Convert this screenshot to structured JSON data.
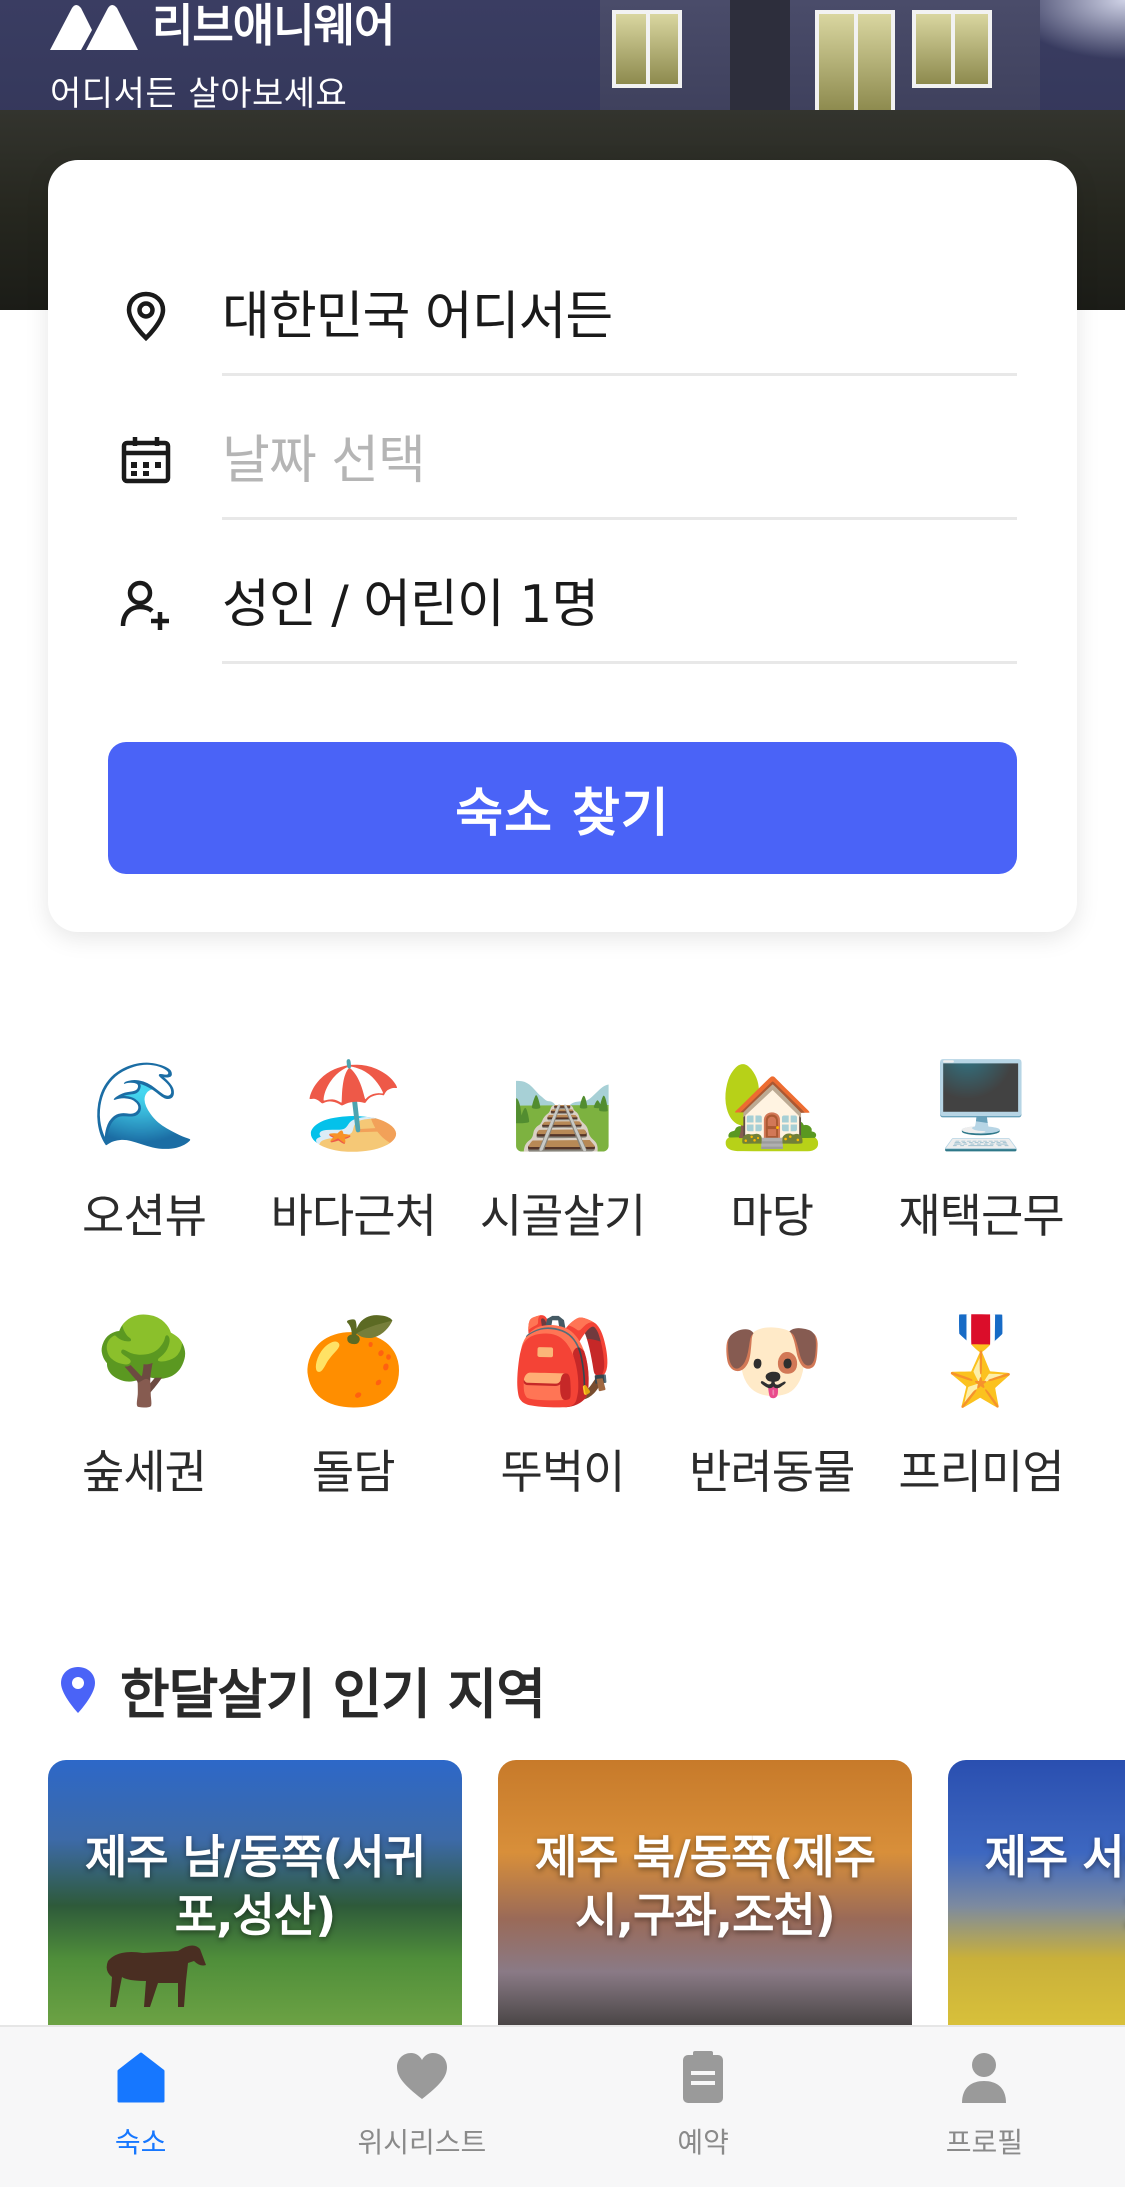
{
  "brand": {
    "name": "리브애니웨어",
    "tagline": "어디서든 살아보세요"
  },
  "search": {
    "location_value": "대한민국 어디서든",
    "date_placeholder": "날짜 선택",
    "guests_value": "성인 / 어린이 1명",
    "submit_label": "숙소 찾기",
    "accent_color": "#4a63f7"
  },
  "categories": [
    {
      "emoji": "🌊",
      "label": "오션뷰"
    },
    {
      "emoji": "🏖️",
      "label": "바다근처"
    },
    {
      "emoji": "🛤️",
      "label": "시골살기"
    },
    {
      "emoji": "🏡",
      "label": "마당"
    },
    {
      "emoji": "🖥️",
      "label": "재택근무"
    },
    {
      "emoji": "🌳",
      "label": "숲세권"
    },
    {
      "emoji": "🍊",
      "label": "돌담"
    },
    {
      "emoji": "🎒",
      "label": "뚜벅이"
    },
    {
      "emoji": "🐶",
      "label": "반려동물"
    },
    {
      "emoji": "🎖️",
      "label": "프리미엄"
    }
  ],
  "popular": {
    "title": "한달살기 인기 지역",
    "regions": [
      {
        "title": "제주 남/동쪽(서귀포,성산)"
      },
      {
        "title": "제주 북/동쪽(제주시,구좌,조천)"
      },
      {
        "title": "제주 서쪽(한림,협재)"
      }
    ]
  },
  "nav": {
    "items": [
      {
        "label": "숙소",
        "icon": "home-icon",
        "active": true
      },
      {
        "label": "위시리스트",
        "icon": "heart-icon",
        "active": false
      },
      {
        "label": "예약",
        "icon": "clipboard-icon",
        "active": false
      },
      {
        "label": "프로필",
        "icon": "person-icon",
        "active": false
      }
    ],
    "active_color": "#1677ff",
    "inactive_color": "#9a9a9a"
  }
}
